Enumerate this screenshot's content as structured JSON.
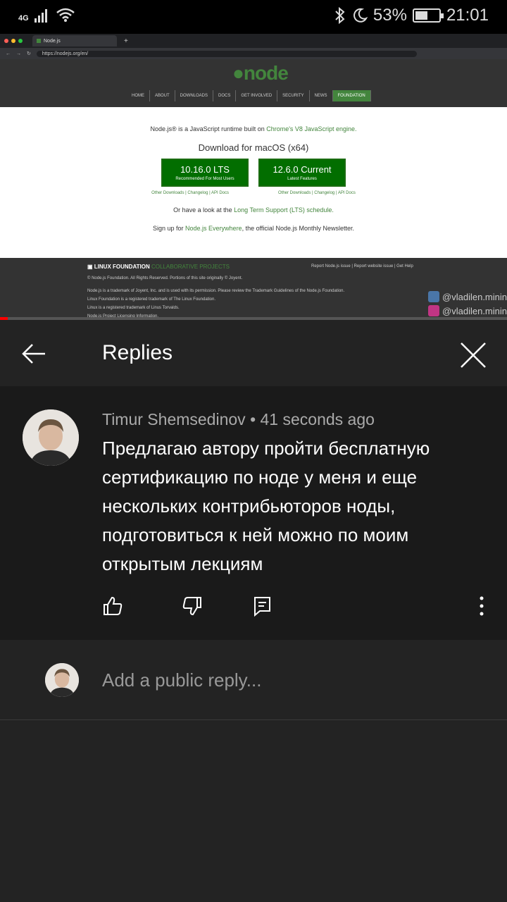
{
  "status_bar": {
    "network": "4G",
    "battery_percent": "53%",
    "battery_level": 0.53,
    "time": "21:01"
  },
  "video": {
    "browser": {
      "tab_title": "Node.js",
      "url": "https://nodejs.org/en/"
    },
    "site": {
      "logo": "node",
      "nav": [
        "HOME",
        "ABOUT",
        "DOWNLOADS",
        "DOCS",
        "GET INVOLVED",
        "SECURITY",
        "NEWS",
        "FOUNDATION"
      ],
      "intro_prefix": "Node.js® is a JavaScript runtime built on ",
      "intro_link": "Chrome's V8 JavaScript engine.",
      "download_title": "Download for macOS (x64)",
      "lts_version": "10.16.0 LTS",
      "lts_sub": "Recommended For Most Users",
      "current_version": "12.6.0 Current",
      "current_sub": "Latest Features",
      "other_links": "Other Downloads | Changelog | API Docs",
      "lts_prefix": "Or have a look at the ",
      "lts_link": "Long Term Support (LTS) schedule.",
      "signup_prefix": "Sign up for ",
      "signup_link": "Node.js Everywhere",
      "signup_suffix": ", the official Node.js Monthly Newsletter.",
      "footer_lf": "LINUX FOUNDATION",
      "footer_lf_sub": "COLLABORATIVE PROJECTS",
      "footer_report": "Report Node.js issue | Report website issue | Get Help",
      "footer_lines": [
        "© Node.js Foundation. All Rights Reserved. Portions of this site originally © Joyent.",
        "Node.js is a trademark of Joyent, Inc. and is used with its permission. Please review the Trademark Guidelines of the Node.js Foundation.",
        "Linux Foundation is a registered trademark of The Linux Foundation.",
        "Linux is a registered trademark of Linus Torvalds.",
        "Node.js Project Licensing Information."
      ]
    },
    "watermarks": [
      "@vladilen.minin",
      "@vladilen.minin"
    ],
    "progress": 0.015
  },
  "header": {
    "title": "Replies"
  },
  "comment": {
    "author": "Timur Shemsedinov",
    "time": "41 seconds ago",
    "text": "Предлагаю автору пройти бесплатную сертификацию по ноде у меня и еще нескольких контрибьюторов ноды, подготовиться к ней можно по моим открытым лекциям"
  },
  "reply": {
    "placeholder": "Add a public reply..."
  },
  "colors": {
    "node_green": "#43853d",
    "background": "#232323",
    "comment_bg": "#1a1a1a"
  }
}
